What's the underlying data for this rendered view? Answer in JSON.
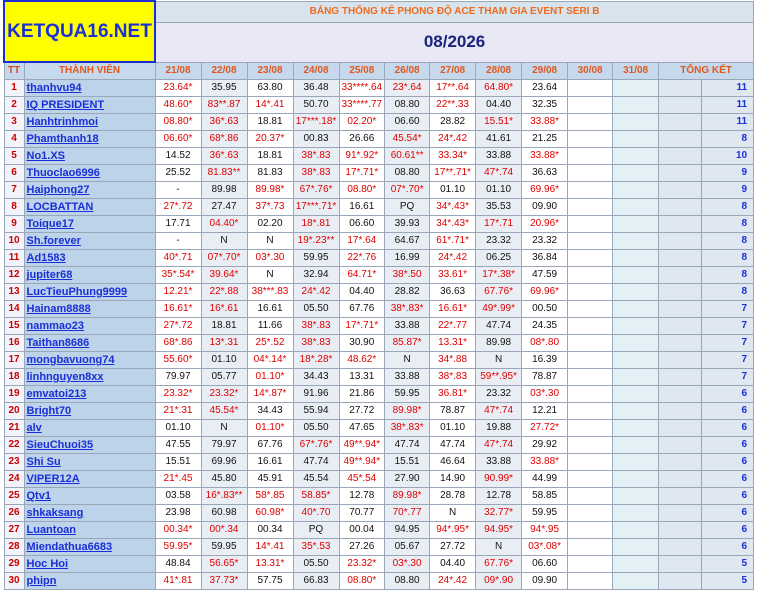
{
  "logo": "KETQUA16.NET",
  "title": "BẢNG THỐNG KÊ PHONG ĐỘ ACE THAM GIA EVENT SERI B",
  "month": "08/2026",
  "headers": {
    "tt": "TT",
    "member": "THÀNH VIÊN",
    "dates": [
      "21/08",
      "22/08",
      "23/08",
      "24/08",
      "25/08",
      "26/08",
      "27/08",
      "28/08",
      "29/08",
      "30/08",
      "31/08"
    ],
    "total": "TỔNG KẾT"
  },
  "rows": [
    {
      "tt": "1",
      "name": "thanhvu94",
      "vals": [
        "23.64*",
        "35.95",
        "63.80",
        "36.48",
        "33****.64",
        "23*.64",
        "17**.64",
        "64.80*",
        "23.64"
      ],
      "total": "11"
    },
    {
      "tt": "2",
      "name": "IQ PRESIDENT",
      "vals": [
        "48.60*",
        "83**.87",
        "14*.41",
        "50.70",
        "33****.77",
        "08.80",
        "22**.33",
        "04.40",
        "32.35"
      ],
      "total": "11"
    },
    {
      "tt": "3",
      "name": "Hanhtrinhmoi",
      "vals": [
        "08.80*",
        "36*.63",
        "18.81",
        "17***.18*",
        "02.20*",
        "06.60",
        "28.82",
        "15.51*",
        "33.88*"
      ],
      "total": "11"
    },
    {
      "tt": "4",
      "name": "Phamthanh18",
      "vals": [
        "06.60*",
        "68*.86",
        "20.37*",
        "00.83",
        "26.66",
        "45.54*",
        "24*.42",
        "41.61",
        "21.25"
      ],
      "total": "8"
    },
    {
      "tt": "5",
      "name": "No1.XS",
      "vals": [
        "14.52",
        "36*.63",
        "18.81",
        "38*.83",
        "91*.92*",
        "60.61**",
        "33.34*",
        "33.88",
        "33.88*"
      ],
      "total": "10"
    },
    {
      "tt": "6",
      "name": "Thuoclao6996",
      "vals": [
        "25.52",
        "81.83**",
        "81.83",
        "38*.83",
        "17*.71*",
        "08.80",
        "17**.71*",
        "47*.74",
        "36.63"
      ],
      "total": "9"
    },
    {
      "tt": "7",
      "name": "Haiphong27",
      "vals": [
        "-",
        "89.98",
        "89.98*",
        "67*.76*",
        "08.80*",
        "07*.70*",
        "01.10",
        "01.10",
        "69.96*"
      ],
      "total": "9"
    },
    {
      "tt": "8",
      "name": "LOCBATTAN",
      "vals": [
        "27*.72",
        "27.47",
        "37*.73",
        "17***.71*",
        "16.61",
        "PQ",
        "34*.43*",
        "35.53",
        "09.90"
      ],
      "total": "8"
    },
    {
      "tt": "9",
      "name": "Toique17",
      "vals": [
        "17.71",
        "04.40*",
        "02.20",
        "18*.81",
        "06.60",
        "39.93",
        "34*.43*",
        "17*.71",
        "20.96*"
      ],
      "total": "8"
    },
    {
      "tt": "10",
      "name": "Sh.forever",
      "vals": [
        "-",
        "N",
        "N",
        "19*.23**",
        "17*.64",
        "64.67",
        "61*.71*",
        "23.32",
        "23.32"
      ],
      "total": "8"
    },
    {
      "tt": "11",
      "name": "Ad1583",
      "vals": [
        "40*.71",
        "07*.70*",
        "03*.30",
        "59.95",
        "22*.76",
        "16.99",
        "24*.42",
        "06.25",
        "36.84"
      ],
      "total": "8"
    },
    {
      "tt": "12",
      "name": "jupiter68",
      "vals": [
        "35*.54*",
        "39.64*",
        "N",
        "32.94",
        "64.71*",
        "38*.50",
        "33.61*",
        "17*.38*",
        "47.59"
      ],
      "total": "8"
    },
    {
      "tt": "13",
      "name": "LucTieuPhung9999",
      "vals": [
        "12.21*",
        "22*.88",
        "38***.83",
        "24*.42",
        "04.40",
        "28.82",
        "36.63",
        "67.76*",
        "69.96*"
      ],
      "total": "8"
    },
    {
      "tt": "14",
      "name": "Hainam8888",
      "vals": [
        "16.61*",
        "16*.61",
        "16.61",
        "05.50",
        "67.76",
        "38*.83*",
        "16.61*",
        "49*.99*",
        "00.50"
      ],
      "total": "7"
    },
    {
      "tt": "15",
      "name": "nammao23",
      "vals": [
        "27*.72",
        "18.81",
        "11.66",
        "38*.83",
        "17*.71*",
        "33.88",
        "22*.77",
        "47.74",
        "24.35"
      ],
      "total": "7"
    },
    {
      "tt": "16",
      "name": "Taithan8686",
      "vals": [
        "68*.86",
        "13*.31",
        "25*.52",
        "38*.83",
        "30.90",
        "85.87*",
        "13.31*",
        "89.98",
        "08*.80"
      ],
      "total": "7"
    },
    {
      "tt": "17",
      "name": "mongbavuong74",
      "vals": [
        "55.60*",
        "01.10",
        "04*.14*",
        "18*.28*",
        "48.62*",
        "N",
        "34*.88",
        "N",
        "16.39"
      ],
      "total": "7"
    },
    {
      "tt": "18",
      "name": "linhnguyen8xx",
      "vals": [
        "79.97",
        "05.77",
        "01.10*",
        "34.43",
        "13.31",
        "33.88",
        "38*.83",
        "59**.95*",
        "78.87"
      ],
      "total": "7"
    },
    {
      "tt": "19",
      "name": "emvatoi213",
      "vals": [
        "23.32*",
        "23.32*",
        "14*.87*",
        "91.96",
        "21.86",
        "59.95",
        "36.81*",
        "23.32",
        "03*.30"
      ],
      "total": "6"
    },
    {
      "tt": "20",
      "name": "Bright70",
      "vals": [
        "21*.31",
        "45.54*",
        "34.43",
        "55.94",
        "27.72",
        "89.98*",
        "78.87",
        "47*.74",
        "12.21"
      ],
      "total": "6"
    },
    {
      "tt": "21",
      "name": "alv",
      "vals": [
        "01.10",
        "N",
        "01.10*",
        "05.50",
        "47.65",
        "38*.83*",
        "01.10",
        "19.88",
        "27.72*"
      ],
      "total": "6"
    },
    {
      "tt": "22",
      "name": "SieuChuoi35",
      "vals": [
        "47.55",
        "79.97",
        "67.76",
        "67*.76*",
        "49**.94*",
        "47.74",
        "47.74",
        "47*.74",
        "29.92"
      ],
      "total": "6"
    },
    {
      "tt": "23",
      "name": "Shi Su",
      "vals": [
        "15.51",
        "69.96",
        "16.61",
        "47.74",
        "49**.94*",
        "15.51",
        "46.64",
        "33.88",
        "33.88*"
      ],
      "total": "6"
    },
    {
      "tt": "24",
      "name": "VIPER12A",
      "vals": [
        "21*.45",
        "45.80",
        "45.91",
        "45.54",
        "45*.54",
        "27.90",
        "14.90",
        "90.99*",
        "44.99"
      ],
      "total": "6"
    },
    {
      "tt": "25",
      "name": "Qtv1",
      "vals": [
        "03.58",
        "16*.83**",
        "58*.85",
        "58.85*",
        "12.78",
        "89.98*",
        "28.78",
        "12.78",
        "58.85"
      ],
      "total": "6"
    },
    {
      "tt": "26",
      "name": "shkaksang",
      "vals": [
        "23.98",
        "60.98",
        "60.98*",
        "40*.70",
        "70.77",
        "70*.77",
        "N",
        "32.77*",
        "59.95"
      ],
      "total": "6"
    },
    {
      "tt": "27",
      "name": "Luantoan",
      "vals": [
        "00.34*",
        "00*.34",
        "00.34",
        "PQ",
        "00.04",
        "94.95",
        "94*.95*",
        "94.95*",
        "94*.95"
      ],
      "total": "6"
    },
    {
      "tt": "28",
      "name": "Miendathua6683",
      "vals": [
        "59.95*",
        "59.95",
        "14*.41",
        "35*.53",
        "27.26",
        "05.67",
        "27.72",
        "N",
        "03*.08*"
      ],
      "total": "6"
    },
    {
      "tt": "29",
      "name": "Hoc Hoi",
      "vals": [
        "48.84",
        "56.65*",
        "13.31*",
        "05.50",
        "23.32*",
        "03*.30",
        "04.40",
        "67.76*",
        "06.60"
      ],
      "total": "5"
    },
    {
      "tt": "30",
      "name": "phipn",
      "vals": [
        "41*.81",
        "37.73*",
        "57.75",
        "66.83",
        "08.80*",
        "08.80",
        "24*.42",
        "09*.90",
        "09.90"
      ],
      "total": "5"
    }
  ],
  "colors": {
    "value_red": "#e00000",
    "value_black": "#111111",
    "name_blue": "#1b2fd6",
    "header_orange": "#e2571e",
    "logo_bg": "#ffff00"
  }
}
